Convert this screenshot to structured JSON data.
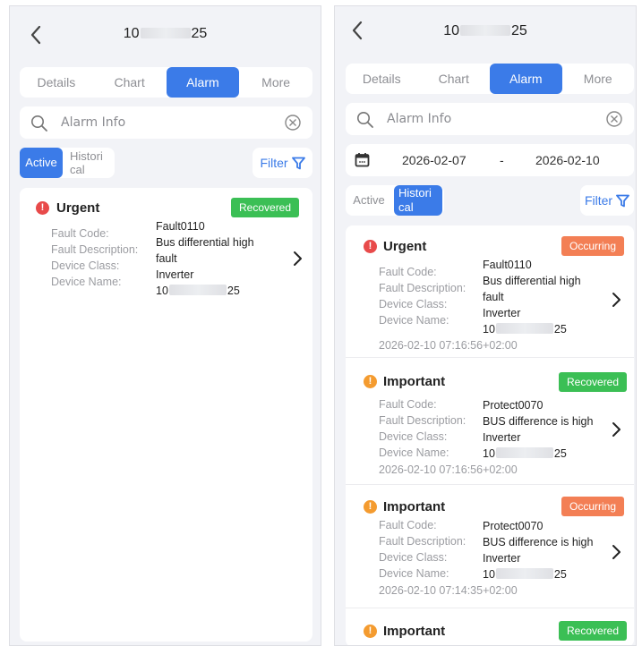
{
  "colors": {
    "accent": "#3b7be8",
    "urgent": "#e84a4a",
    "important": "#f49b2f",
    "recovered": "#3bbf55",
    "occurring": "#f37f55"
  },
  "left": {
    "title_prefix": "10",
    "title_suffix": "25",
    "tabs": [
      "Details",
      "Chart",
      "Alarm",
      "More"
    ],
    "active_tab": "Alarm",
    "search_placeholder": "Alarm Info",
    "segment": {
      "active": "Active",
      "hist_line1": "Histori",
      "hist_line2": "cal",
      "selected": "Active"
    },
    "filter_label": "Filter",
    "alarms": [
      {
        "level": "Urgent",
        "status": "Recovered",
        "labels": [
          "Fault Code:",
          "Fault Description:",
          "Device Class:",
          "Device Name:"
        ],
        "fault_code": "Fault0110",
        "desc_line1": "Bus differential high",
        "desc_line2": "fault",
        "device_class": "Inverter",
        "name_prefix": "10",
        "name_suffix": "25"
      }
    ]
  },
  "right": {
    "title_prefix": "10",
    "title_suffix": "25",
    "tabs": [
      "Details",
      "Chart",
      "Alarm",
      "More"
    ],
    "active_tab": "Alarm",
    "search_placeholder": "Alarm Info",
    "date_from": "2026-02-07",
    "date_sep": "-",
    "date_to": "2026-02-10",
    "segment": {
      "active": "Active",
      "hist_line1": "Histori",
      "hist_line2": "cal",
      "selected": "Historical"
    },
    "filter_label": "Filter",
    "alarms": [
      {
        "level": "Urgent",
        "status": "Occurring",
        "labels": [
          "Fault Code:",
          "Fault Description:",
          "Device Class:",
          "Device Name:"
        ],
        "fault_code": "Fault0110",
        "desc_line1": "Bus differential high",
        "desc_line2": "fault",
        "device_class": "Inverter",
        "name_prefix": "10",
        "name_suffix": "25",
        "time": "2026-02-10 07:16:56+02:00"
      },
      {
        "level": "Important",
        "status": "Recovered",
        "labels": [
          "Fault Code:",
          "Fault Description:",
          "Device Class:",
          "Device Name:"
        ],
        "fault_code": "Protect0070",
        "desc_line1": "BUS difference is high",
        "device_class": "Inverter",
        "name_prefix": "10",
        "name_suffix": "25",
        "time": "2026-02-10 07:16:56+02:00"
      },
      {
        "level": "Important",
        "status": "Occurring",
        "labels": [
          "Fault Code:",
          "Fault Description:",
          "Device Class:",
          "Device Name:"
        ],
        "fault_code": "Protect0070",
        "desc_line1": "BUS difference is high",
        "device_class": "Inverter",
        "name_prefix": "10",
        "name_suffix": "25",
        "time": "2026-02-10 07:14:35+02:00"
      },
      {
        "level": "Important",
        "status": "Recovered"
      }
    ]
  }
}
